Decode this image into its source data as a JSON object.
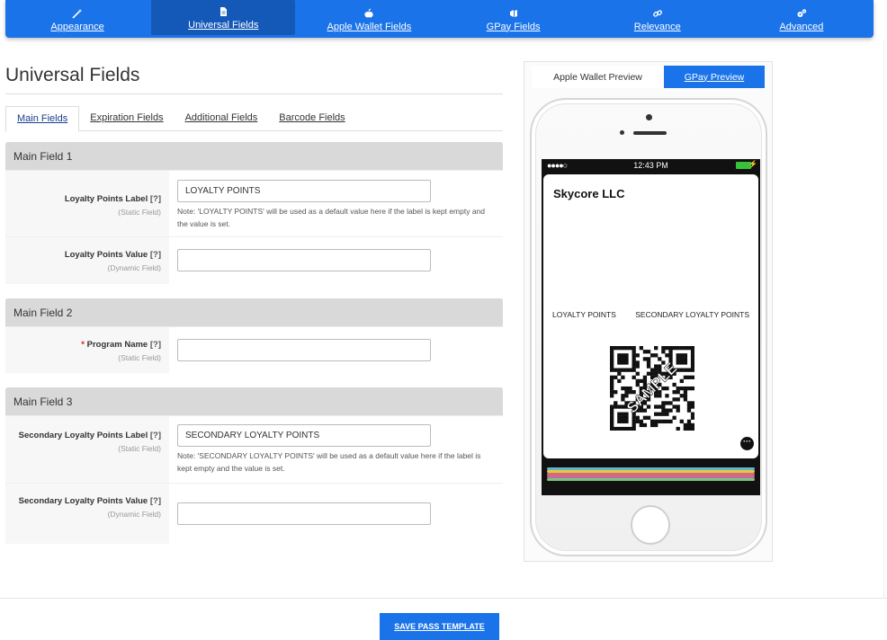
{
  "nav": {
    "items": [
      {
        "label": "Appearance",
        "icon": "magic-wand-icon"
      },
      {
        "label": "Universal Fields",
        "icon": "document-icon"
      },
      {
        "label": "Apple Wallet Fields",
        "icon": "apple-icon"
      },
      {
        "label": "GPay Fields",
        "icon": "gpay-icon"
      },
      {
        "label": "Relevance",
        "icon": "link-icon"
      },
      {
        "label": "Advanced",
        "icon": "gears-icon"
      }
    ],
    "active_index": 1,
    "accent": "#1a73e8"
  },
  "page": {
    "title": "Universal Fields"
  },
  "subtabs": [
    "Main Fields",
    "Expiration Fields",
    "Additional Fields",
    "Barcode Fields"
  ],
  "sections": [
    {
      "title": "Main Field 1",
      "rows": [
        {
          "label": "Loyalty Points Label",
          "help": "[?]",
          "hint": "(Static Field)",
          "value": "LOYALTY POINTS",
          "note": "Note: 'LOYALTY POINTS' will be used as a default value here if the label is kept empty and the value is set."
        },
        {
          "label": "Loyalty Points Value",
          "help": "[?]",
          "hint": "(Dynamic Field)",
          "value": ""
        }
      ]
    },
    {
      "title": "Main Field 2",
      "rows": [
        {
          "required": "*",
          "label": "Program Name",
          "help": "[?]",
          "hint": "(Static Field)",
          "value": ""
        }
      ]
    },
    {
      "title": "Main Field 3",
      "rows": [
        {
          "label": "Secondary Loyalty Points Label",
          "help": "[?]",
          "hint": "(Static Field)",
          "value": "SECONDARY LOYALTY POINTS",
          "note": "Note: 'SECONDARY LOYALTY POINTS' will be used as a default value here if the label is kept empty and the value is set."
        },
        {
          "label": "Secondary Loyalty Points Value",
          "help": "[?]",
          "hint": "(Dynamic Field)",
          "value": ""
        }
      ]
    }
  ],
  "preview": {
    "tabs": [
      "Apple Wallet Preview",
      "GPay Preview"
    ],
    "status_time": "12:43 PM",
    "status_dots": "●●●●○",
    "org_name": "Skycore LLC",
    "field1_label": "LOYALTY POINTS",
    "field2_label": "SECONDARY LOYALTY POINTS",
    "barcode_watermark": "SAMPLE",
    "more_glyph": "···",
    "stack_colors": [
      "#5fb8c4",
      "#e7c64d",
      "#d96b6b",
      "#c36aa6",
      "#7cc47a"
    ]
  },
  "footer": {
    "save_label": "SAVE PASS TEMPLATE"
  }
}
